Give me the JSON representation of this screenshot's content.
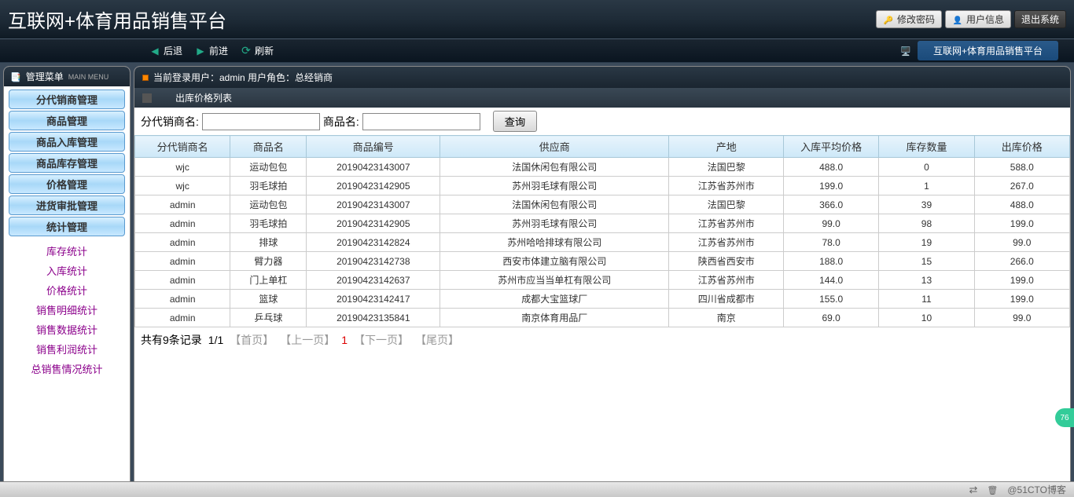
{
  "banner": {
    "title": "互联网+体育用品销售平台",
    "buttons": {
      "change_pw": "修改密码",
      "user_info": "用户信息",
      "logout": "退出系统"
    }
  },
  "nav": {
    "back": "后退",
    "forward": "前进",
    "refresh": "刷新",
    "platform_title": "互联网+体育用品销售平台"
  },
  "sidebar": {
    "header": "管理菜单",
    "main_menu": "MAIN MENU",
    "items": [
      "分代销商管理",
      "商品管理",
      "商品入库管理",
      "商品库存管理",
      "价格管理",
      "进货审批管理",
      "统计管理"
    ],
    "sublinks": [
      "库存统计",
      "入库统计",
      "价格统计",
      "销售明细统计",
      "销售数据统计",
      "销售利润统计",
      "总销售情况统计"
    ]
  },
  "content": {
    "user_bar": "当前登录用户：admin 用户角色：总经销商",
    "sub_header": "出库价格列表",
    "search": {
      "dealer_label": "分代销商名:",
      "product_label": "商品名:",
      "query_btn": "查询"
    },
    "table": {
      "headers": [
        "分代销商名",
        "商品名",
        "商品编号",
        "供应商",
        "产地",
        "入库平均价格",
        "库存数量",
        "出库价格"
      ],
      "rows": [
        [
          "wjc",
          "运动包包",
          "20190423143007",
          "法国休闲包有限公司",
          "法国巴黎",
          "488.0",
          "0",
          "588.0"
        ],
        [
          "wjc",
          "羽毛球拍",
          "20190423142905",
          "苏州羽毛球有限公司",
          "江苏省苏州市",
          "199.0",
          "1",
          "267.0"
        ],
        [
          "admin",
          "运动包包",
          "20190423143007",
          "法国休闲包有限公司",
          "法国巴黎",
          "366.0",
          "39",
          "488.0"
        ],
        [
          "admin",
          "羽毛球拍",
          "20190423142905",
          "苏州羽毛球有限公司",
          "江苏省苏州市",
          "99.0",
          "98",
          "199.0"
        ],
        [
          "admin",
          "排球",
          "20190423142824",
          "苏州哈哈排球有限公司",
          "江苏省苏州市",
          "78.0",
          "19",
          "99.0"
        ],
        [
          "admin",
          "臂力器",
          "20190423142738",
          "西安市体建立脑有限公司",
          "陕西省西安市",
          "188.0",
          "15",
          "266.0"
        ],
        [
          "admin",
          "门上单杠",
          "20190423142637",
          "苏州市应当当单杠有限公司",
          "江苏省苏州市",
          "144.0",
          "13",
          "199.0"
        ],
        [
          "admin",
          "篮球",
          "20190423142417",
          "成都大宝篮球厂",
          "四川省成都市",
          "155.0",
          "11",
          "199.0"
        ],
        [
          "admin",
          "乒乓球",
          "20190423135841",
          "南京体育用品厂",
          "南京",
          "69.0",
          "10",
          "99.0"
        ]
      ]
    },
    "pagination": {
      "info": "共有9条记录",
      "page_num": "1/1",
      "first": "【首页】",
      "prev": "【上一页】",
      "current": "1",
      "next": "【下一页】",
      "last": "【尾页】"
    }
  },
  "footer": {
    "watermark": "@51CTO博客",
    "badge": "76"
  }
}
